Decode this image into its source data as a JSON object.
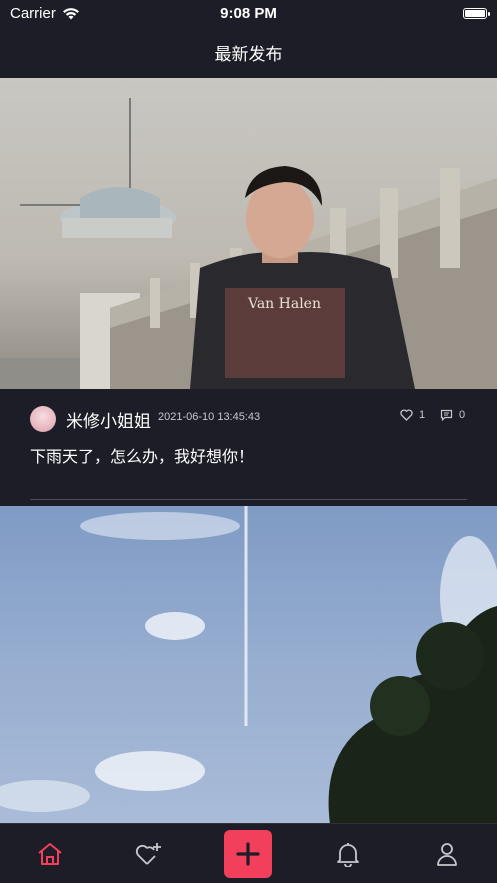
{
  "status_bar": {
    "carrier": "Carrier",
    "time": "9:08 PM"
  },
  "nav": {
    "title": "最新发布"
  },
  "post": {
    "username": "米修小姐姐",
    "time": "2021-06-10 13:45:43",
    "likes": "1",
    "comments": "0",
    "text": "下雨天了，怎么办，我好想你！"
  },
  "colors": {
    "background": "#1c1d26",
    "accent": "#f2405c"
  },
  "tab_bar": {
    "tabs": [
      {
        "icon": "home-icon",
        "active": true
      },
      {
        "icon": "heart-plus-icon",
        "active": false
      },
      {
        "icon": "plus-icon",
        "active": false
      },
      {
        "icon": "bell-icon",
        "active": false
      },
      {
        "icon": "person-icon",
        "active": false
      }
    ]
  }
}
